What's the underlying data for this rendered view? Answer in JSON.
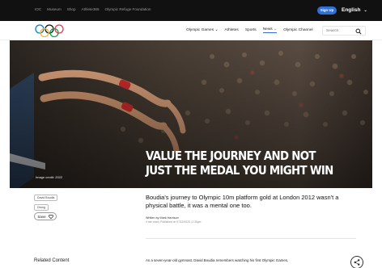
{
  "topbar": {
    "links": [
      "IOC",
      "Museum",
      "Shop",
      "Athlete365",
      "Olympic Refuge Foundation"
    ],
    "signup": "Sign Up",
    "language": "English"
  },
  "nav": {
    "items": [
      "Olympic Games",
      "Athletes",
      "Sports",
      "News",
      "Olympic Channel"
    ],
    "active": "News",
    "search_placeholder": "Search"
  },
  "hero": {
    "headline": "VALUE THE JOURNEY AND NOT JUST THE MEDAL YOU MIGHT WIN",
    "credit": "Image credit: 2022"
  },
  "article": {
    "tags": [
      "David Boudia",
      "Diving"
    ],
    "save_label": "Save",
    "subhead": "Boudia's journey to Olympic 10m platform gold at London 2012 wasn't a physical battle, it was a mental one too.",
    "byline": "Written by Mark Harrison",
    "meta": "4 min read | Published on 07/12/2020 | 2:30pm"
  },
  "bottom": {
    "related_heading": "Related Content",
    "body_start": "As a seven-year-old gymnast, David Boudia remembers watching his first Olympic Games,"
  },
  "colors": {
    "accent": "#2f6fd6",
    "topbar": "#111111"
  }
}
